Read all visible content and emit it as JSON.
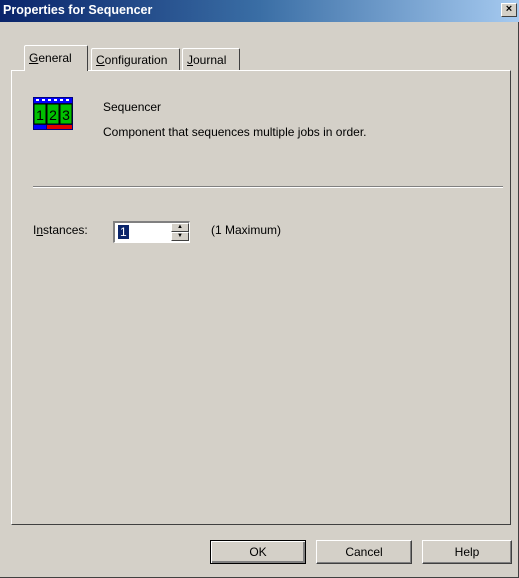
{
  "window": {
    "title": "Properties for Sequencer",
    "close_label": "×"
  },
  "tabs": [
    {
      "label": "General",
      "accesskey": "G",
      "active": true
    },
    {
      "label": "Configuration",
      "accesskey": "C",
      "active": false
    },
    {
      "label": "Journal",
      "accesskey": "J",
      "active": false
    }
  ],
  "component": {
    "icon": "sequencer-123-icon",
    "icon_text": [
      "1",
      "2",
      "3"
    ],
    "name": "Sequencer",
    "description": "Component that sequences multiple jobs in order."
  },
  "instances": {
    "label_before": "I",
    "label_accesskey": "n",
    "label_after": "stances:",
    "value": "1",
    "max_text": "(1 Maximum)"
  },
  "buttons": {
    "ok": "OK",
    "cancel": "Cancel",
    "help": "Help"
  },
  "colors": {
    "title_start": "#0a246a",
    "title_end": "#a6caf0",
    "face": "#d4d0c8",
    "selection": "#0a246a"
  }
}
